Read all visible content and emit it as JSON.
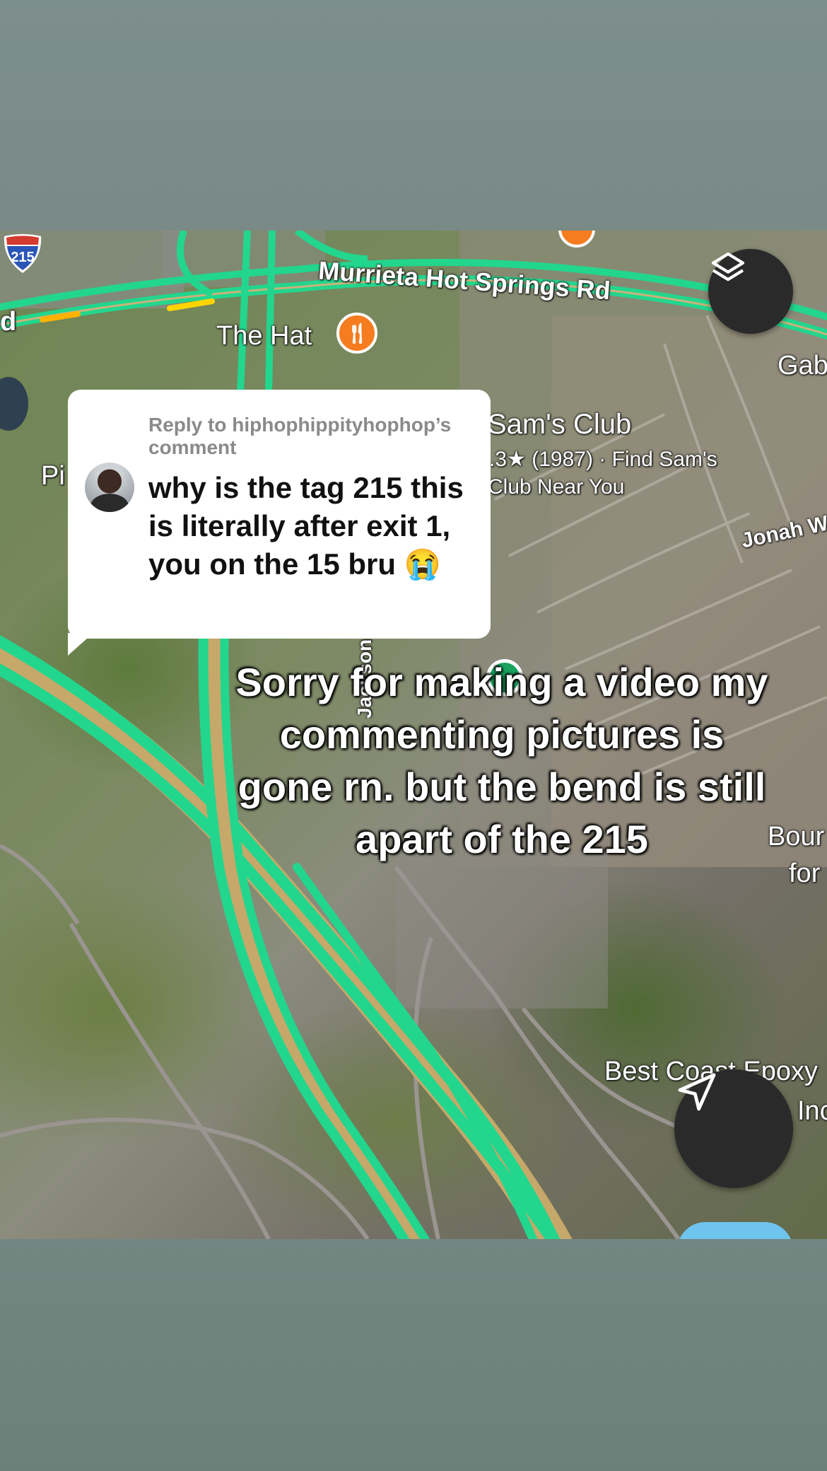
{
  "map": {
    "road_labels": {
      "murrieta_hot_springs": "Murrieta Hot Springs Rd",
      "left_edge_d": "d",
      "gab": "Gab",
      "jonah": "Jonah W",
      "pi": "Pi",
      "jackson_vertical": "Jackson",
      "bour": "Bour",
      "for": "for",
      "best_coast": "Best Coast Epoxy",
      "in": "Inc"
    },
    "places": {
      "the_hat": "The Hat",
      "sams_club_name": "Sam's Club",
      "sams_club_rating": ".3★ (1987) · Find Sam's",
      "sams_club_sub": "Club Near You"
    },
    "highway_shield": "215",
    "colors": {
      "traffic_green": "#22d68d",
      "poi_orange": "#f57c1f",
      "fab_dark": "#2a2a2a"
    }
  },
  "controls": {
    "layers_button_icon": "layers-icon",
    "navigate_button_icon": "navigation-arrow-icon"
  },
  "comment": {
    "reply_to": "Reply to hiphophippityhophop’s comment",
    "text": "why is the tag 215 this is literally after exit 1, you on the 15 bru 😭"
  },
  "caption": "Sorry for making a video my commenting pictures is gone rn. but the bend is still apart of the 215"
}
